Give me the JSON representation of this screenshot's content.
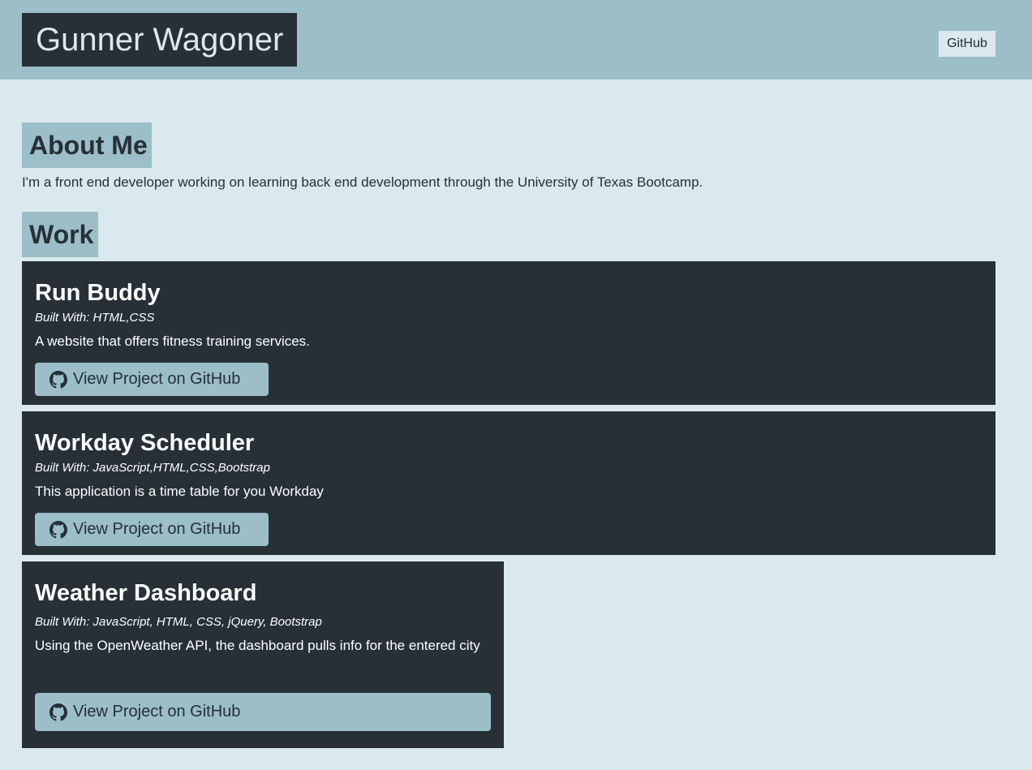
{
  "header": {
    "brand": "Gunner Wagoner",
    "nav_link": "GitHub"
  },
  "about": {
    "heading": "About Me",
    "text": "I'm a front end developer working on learning back end development through the University of Texas Bootcamp."
  },
  "work": {
    "heading": "Work",
    "projects": [
      {
        "title": "Run Buddy",
        "tech": "Built With: HTML,CSS",
        "description": "A website that offers fitness training services.",
        "button": "View Project on GitHub",
        "icon": "github-icon"
      },
      {
        "title": "Workday Scheduler",
        "tech": "Built With: JavaScript,HTML,CSS,Bootstrap",
        "description": "This application is a time table for you Workday",
        "button": "View Project on GitHub",
        "icon": "github-icon"
      },
      {
        "title": "Weather Dashboard",
        "tech": "Built With: JavaScript, HTML, CSS, jQuery, Bootstrap",
        "description": "Using the OpenWeather API, the dashboard pulls info for the entered city",
        "button": "View Project on GitHub",
        "icon": "github-icon"
      }
    ]
  },
  "colors": {
    "page_background": "#dae9ee",
    "accent": "#9bbec8",
    "dark": "#263036"
  }
}
